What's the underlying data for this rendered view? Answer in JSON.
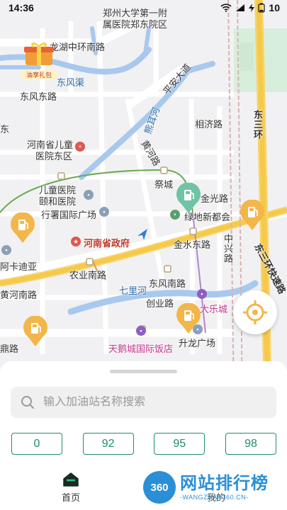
{
  "status_bar": {
    "time": "14:36",
    "battery": "10"
  },
  "map": {
    "labels": {
      "zhengda_hospital_1": "郑州大学第一附",
      "zhengda_hospital_2": "属医院郑东院区",
      "longhu_road": "龙湖中环南路",
      "gift_label": "油享礼包",
      "dongfengqu": "东风渠",
      "dongfeng_east_road": "东风东路",
      "pingan_avenue": "平安大道",
      "xiangji_road": "相济路",
      "ring3_east": "东三环",
      "dong_edge": "东",
      "xiongerhe": "熊耳河",
      "henan_children_1": "河南省儿童",
      "henan_children_2": "医院东区",
      "huangchang_road": "黄河路",
      "children_hospital_1": "儿童医院",
      "children_hospital_2": "颐和医院",
      "jicheng": "祭城",
      "jinguang_road": "金光路",
      "xingshu_plaza": "行署国际广场",
      "xingshu_newcity": "绿地新都会",
      "henan_gov": "河南省政府",
      "jinshui_east_road": "金水东路",
      "zhongxing_road": "中兴路",
      "akadiya": "阿卡迪亚",
      "ring3_east_elevated": "东三环快速路",
      "nongye_south_road": "农业南路",
      "dongfeng_south_road": "东风南路",
      "huanghe_south_road": "黄河南路",
      "qilihe": "七里河",
      "chuangye_road": "创业路",
      "dalecheng": "大乐城",
      "tiane_hotel": "天鹅城国际饭店",
      "shenglong_plaza": "升龙广场",
      "ding_road": "鼎路"
    }
  },
  "search": {
    "placeholder": "输入加油站名称搜索"
  },
  "fuel_types": [
    "0",
    "92",
    "95",
    "98"
  ],
  "tabs": {
    "home": "首页",
    "mine": "我的"
  },
  "watermark": {
    "logo": "360",
    "name": "网站排行榜",
    "url": "-WANGZHAN360.CN-"
  },
  "colors": {
    "accent": "#1e8e6a",
    "road_highway": "#f5c94a",
    "river": "#a9c8ee",
    "gas_marker": "#f3b64a"
  }
}
